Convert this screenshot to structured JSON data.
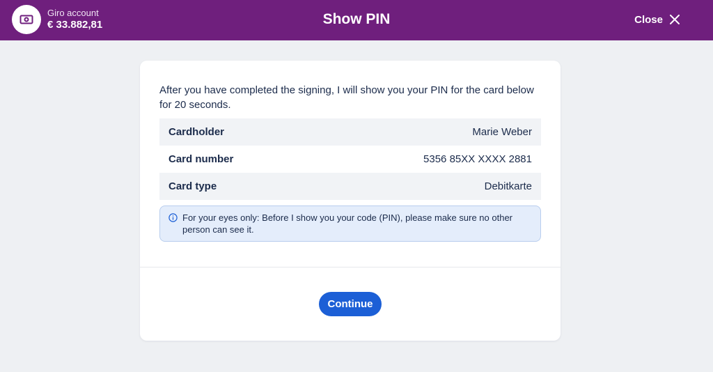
{
  "header": {
    "account_label": "Giro account",
    "account_balance": "€ 33.882,81",
    "account_icon": "banknote-icon",
    "title": "Show PIN",
    "close_label": "Close",
    "close_icon": "close-icon",
    "background_color": "#6f1f7d"
  },
  "dialog": {
    "intro": "After you have completed the signing, I will show you your PIN for the card below for 20 seconds.",
    "details": [
      {
        "key": "Cardholder",
        "value": "Marie Weber"
      },
      {
        "key": "Card number",
        "value": "5356 85XX XXXX 2881"
      },
      {
        "key": "Card type",
        "value": "Debitkarte"
      }
    ],
    "notice": "For your eyes only: Before I show you your code (PIN), please make sure no other person can see it.",
    "notice_icon": "info-icon",
    "continue_label": "Continue",
    "accent_color": "#1c5fd6"
  }
}
